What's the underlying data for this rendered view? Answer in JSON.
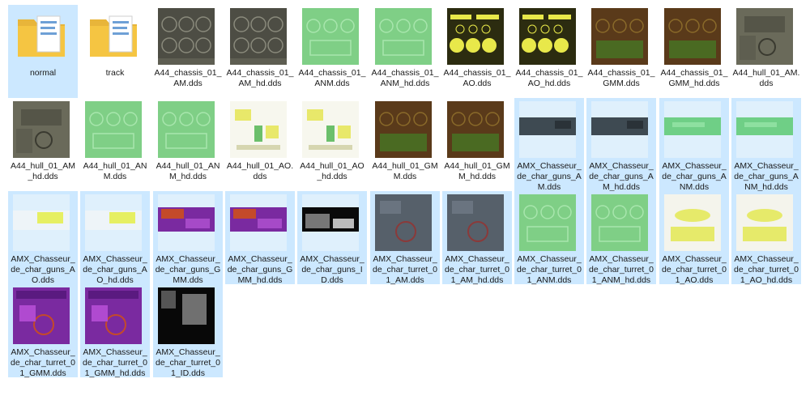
{
  "files": [
    {
      "label": "normal",
      "type": "folder",
      "selected": true
    },
    {
      "label": "track",
      "type": "folder",
      "selected": false
    },
    {
      "label": "A44_chassis_01_AM.dds",
      "type": "gray",
      "selected": false
    },
    {
      "label": "A44_chassis_01_AM_hd.dds",
      "type": "gray",
      "selected": false
    },
    {
      "label": "A44_chassis_01_ANM.dds",
      "type": "green",
      "selected": false
    },
    {
      "label": "A44_chassis_01_ANM_hd.dds",
      "type": "green",
      "selected": false
    },
    {
      "label": "A44_chassis_01_AO.dds",
      "type": "yellow",
      "selected": false
    },
    {
      "label": "A44_chassis_01_AO_hd.dds",
      "type": "yellow",
      "selected": false
    },
    {
      "label": "A44_chassis_01_GMM.dds",
      "type": "brown",
      "selected": false
    },
    {
      "label": "A44_chassis_01_GMM_hd.dds",
      "type": "brown",
      "selected": false
    },
    {
      "label": "A44_hull_01_AM.dds",
      "type": "camo",
      "selected": false
    },
    {
      "label": "A44_hull_01_AM_hd.dds",
      "type": "camo",
      "selected": false
    },
    {
      "label": "A44_hull_01_ANM.dds",
      "type": "green",
      "selected": false
    },
    {
      "label": "A44_hull_01_ANM_hd.dds",
      "type": "green",
      "selected": false
    },
    {
      "label": "A44_hull_01_AO.dds",
      "type": "aolight",
      "selected": false
    },
    {
      "label": "A44_hull_01_AO_hd.dds",
      "type": "aolight",
      "selected": false
    },
    {
      "label": "A44_hull_01_GMM.dds",
      "type": "brown",
      "selected": false
    },
    {
      "label": "A44_hull_01_GMM_hd.dds",
      "type": "brown",
      "selected": false
    },
    {
      "label": "AMX_Chasseur_de_char_guns_AM.dds",
      "type": "darkstrip",
      "selected": true
    },
    {
      "label": "AMX_Chasseur_de_char_guns_AM_hd.dds",
      "type": "darkstrip",
      "selected": true
    },
    {
      "label": "AMX_Chasseur_de_char_guns_ANM.dds",
      "type": "greenstrip",
      "selected": true
    },
    {
      "label": "AMX_Chasseur_de_char_guns_ANM_hd.dds",
      "type": "greenstrip",
      "selected": true
    },
    {
      "label": "AMX_Chasseur_de_char_guns_AO.dds",
      "type": "yellowstrip",
      "selected": true
    },
    {
      "label": "AMX_Chasseur_de_char_guns_AO_hd.dds",
      "type": "yellowstrip",
      "selected": true
    },
    {
      "label": "AMX_Chasseur_de_char_guns_GMM.dds",
      "type": "purplestrip",
      "selected": true
    },
    {
      "label": "AMX_Chasseur_de_char_guns_GMM_hd.dds",
      "type": "purplestrip",
      "selected": true
    },
    {
      "label": "AMX_Chasseur_de_char_guns_ID.dds",
      "type": "idstrip",
      "selected": true
    },
    {
      "label": "AMX_Chasseur_de_char_turret_01_AM.dds",
      "type": "turretgray",
      "selected": true
    },
    {
      "label": "AMX_Chasseur_de_char_turret_01_AM_hd.dds",
      "type": "turretgray",
      "selected": true
    },
    {
      "label": "AMX_Chasseur_de_char_turret_01_ANM.dds",
      "type": "green",
      "selected": true
    },
    {
      "label": "AMX_Chasseur_de_char_turret_01_ANM_hd.dds",
      "type": "green",
      "selected": true
    },
    {
      "label": "AMX_Chasseur_de_char_turret_01_AO.dds",
      "type": "turretao",
      "selected": true
    },
    {
      "label": "AMX_Chasseur_de_char_turret_01_AO_hd.dds",
      "type": "turretao",
      "selected": true
    },
    {
      "label": "AMX_Chasseur_de_char_turret_01_GMM.dds",
      "type": "purple",
      "selected": true
    },
    {
      "label": "AMX_Chasseur_de_char_turret_01_GMM_hd.dds",
      "type": "purple",
      "selected": true
    },
    {
      "label": "AMX_Chasseur_de_char_turret_01_ID.dds",
      "type": "idblack",
      "selected": true
    }
  ],
  "colors": {
    "selection_bg": "#cce8ff",
    "folder": "#f5c542"
  }
}
